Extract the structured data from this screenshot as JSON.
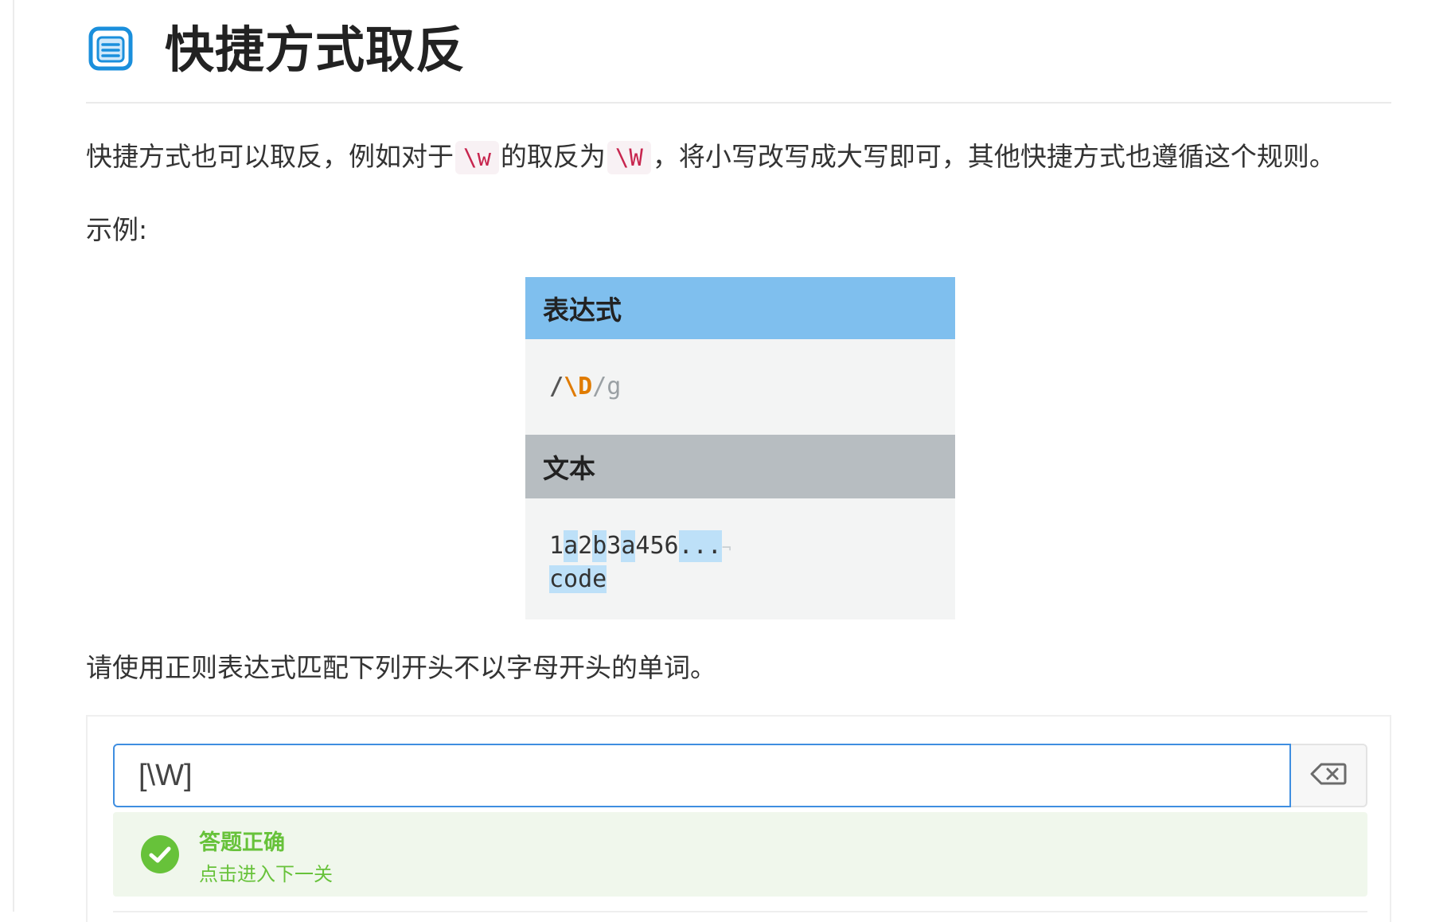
{
  "page": {
    "title": "快捷方式取反",
    "title_icon": "document-list-icon",
    "accent_color": "#1a8fdc"
  },
  "intro": {
    "before_code1": "快捷方式也可以取反，例如对于",
    "code1": "\\w",
    "between": "的取反为",
    "code2": "\\W",
    "after": "，将小写改写成大写即可，其他快捷方式也遵循这个规则。"
  },
  "example_label": "示例:",
  "example": {
    "expression_header": "表达式",
    "expression": {
      "prefix": "/",
      "core": "\\D",
      "suffix": "/g"
    },
    "text_header": "文本",
    "text_line1": [
      {
        "c": "1",
        "hl": false
      },
      {
        "c": "a",
        "hl": true
      },
      {
        "c": "2",
        "hl": false
      },
      {
        "c": "b",
        "hl": true
      },
      {
        "c": "3",
        "hl": false
      },
      {
        "c": "a",
        "hl": true
      },
      {
        "c": "4",
        "hl": false
      },
      {
        "c": "5",
        "hl": false
      },
      {
        "c": "6",
        "hl": false
      },
      {
        "c": ".",
        "hl": true
      },
      {
        "c": ".",
        "hl": true
      },
      {
        "c": ".",
        "hl": true
      }
    ],
    "text_line1_end": "¬",
    "text_line2": "code"
  },
  "task": "请使用正则表达式匹配下列开头不以字母开头的单词。",
  "answer": {
    "value": "[\\W]",
    "clear_icon": "backspace-icon"
  },
  "result": {
    "status": "success",
    "icon": "check-circle-icon",
    "title": "答题正确",
    "link": "点击进入下一关",
    "color": "#67c23a"
  }
}
